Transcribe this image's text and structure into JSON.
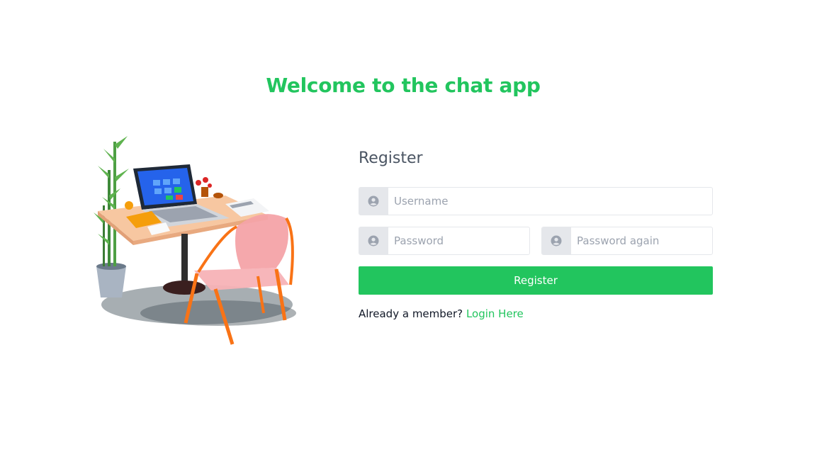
{
  "page": {
    "title": "Welcome to the chat app"
  },
  "illustration": {
    "alt": "desk-with-laptop-and-chair"
  },
  "form": {
    "title": "Register",
    "username": {
      "placeholder": "Username",
      "value": "",
      "icon": "user-icon"
    },
    "password": {
      "placeholder": "Password",
      "value": "",
      "icon": "user-icon"
    },
    "password_again": {
      "placeholder": "Password again",
      "value": "",
      "icon": "user-icon"
    },
    "submit_label": "Register"
  },
  "footer": {
    "prompt": "Already a member?",
    "link_label": "Login Here"
  },
  "colors": {
    "accent": "#22c55e",
    "addon_bg": "#e5e7eb",
    "text": "#4b5563"
  }
}
